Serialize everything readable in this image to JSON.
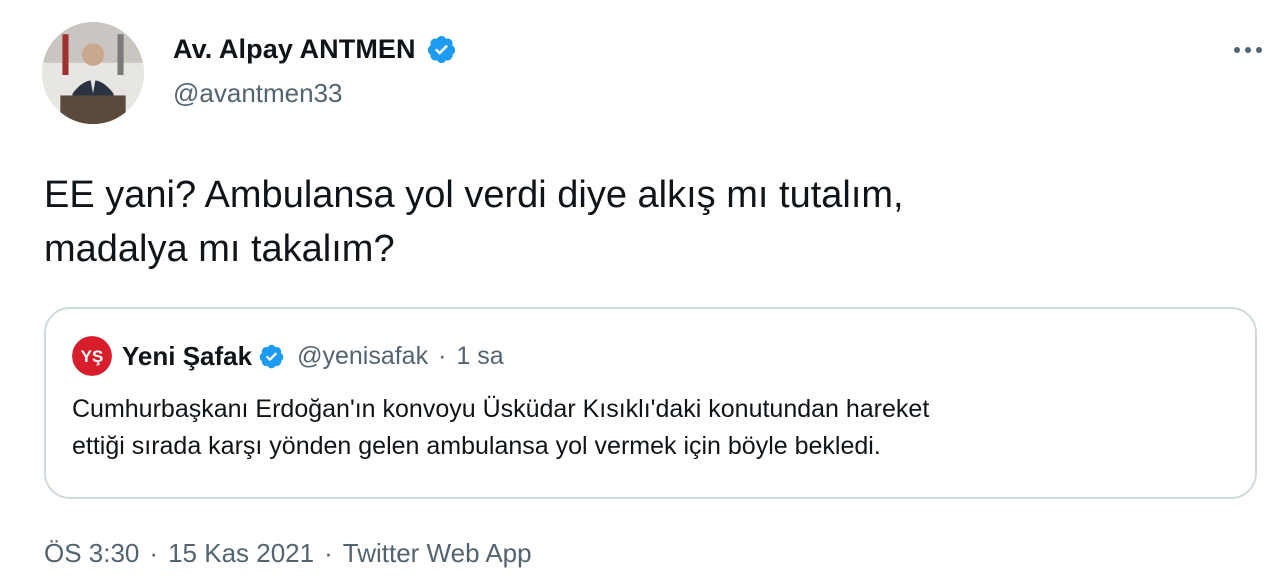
{
  "author": {
    "display_name": "Av. Alpay ANTMEN",
    "handle": "@avantmen33",
    "verified": true
  },
  "icons": {
    "verified_badge": "verified-badge-icon",
    "more": "more-options-icon"
  },
  "colors": {
    "verified_blue": "#1d9bf0",
    "secondary_text": "#536471",
    "border": "#cfd9de",
    "yeni_safak_red": "#d81e2a"
  },
  "tweet": {
    "text_line1": "EE yani? Ambulansa yol verdi diye alkış mı tutalım,",
    "text_line2": "madalya mı takalım?"
  },
  "quoted_tweet": {
    "display_name": "Yeni Şafak",
    "handle": "@yenisafak",
    "separator": "·",
    "time": "1 sa",
    "avatar_label": "YŞ",
    "text_line1": "Cumhurbaşkanı Erdoğan'ın konvoyu Üsküdar Kısıklı'daki konutundan hareket",
    "text_line2": "ettiği sırada karşı yönden gelen ambulansa yol vermek için böyle bekledi."
  },
  "meta": {
    "time": "ÖS 3:30",
    "separator1": "·",
    "date": "15 Kas 2021",
    "separator2": "·",
    "source": "Twitter Web App"
  }
}
